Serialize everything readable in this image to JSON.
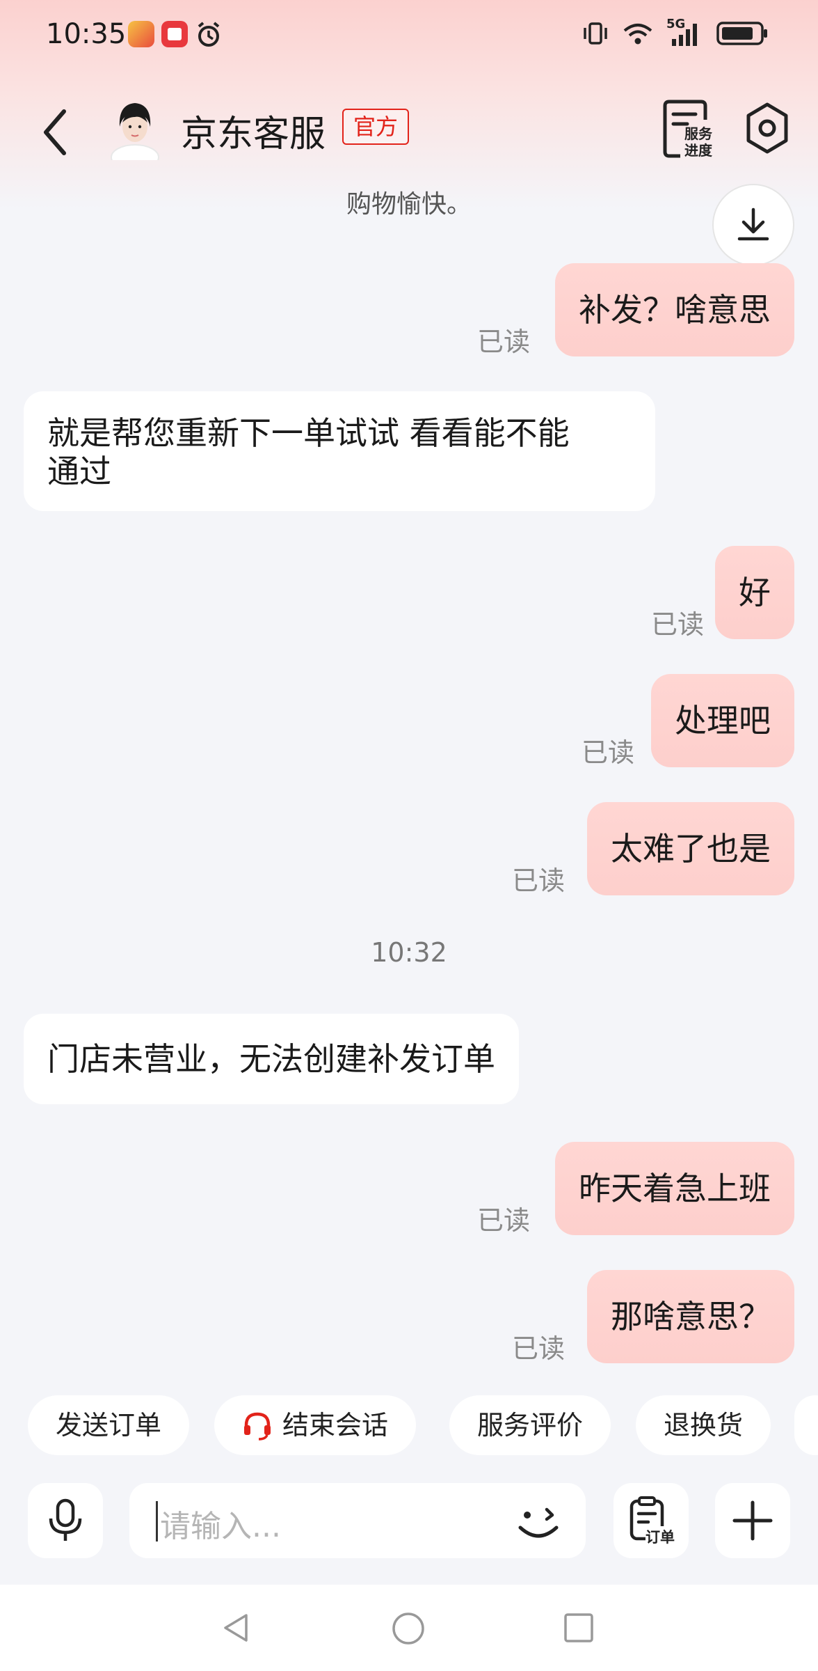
{
  "status_bar": {
    "time": "10:35",
    "network": "5G"
  },
  "header": {
    "agent_name": "京东客服",
    "badge": "官方",
    "progress_label_line1": "服务",
    "progress_label_line2": "进度"
  },
  "system_text": "购物愉快。",
  "messages": [
    {
      "dir": "out",
      "text": "补发？啥意思",
      "status": "已读"
    },
    {
      "dir": "in",
      "line1": "就是帮您重新下一单试试 看看能不能",
      "line2": "通过"
    },
    {
      "dir": "out",
      "text": "好",
      "status": "已读"
    },
    {
      "dir": "out",
      "text": "处理吧",
      "status": "已读"
    },
    {
      "dir": "out",
      "text": "太难了也是",
      "status": "已读"
    },
    {
      "dir": "in",
      "text": "门店未营业，无法创建补发订单"
    },
    {
      "dir": "out",
      "text": "昨天着急上班",
      "status": "已读"
    },
    {
      "dir": "out",
      "text": "那啥意思？",
      "status": "已读"
    }
  ],
  "time_separator": "10:32",
  "quick_actions": [
    "发送订单",
    "结束会话",
    "服务评价",
    "退换货"
  ],
  "input": {
    "placeholder": "请输入...",
    "order_label": "订单"
  },
  "colors": {
    "accent_red": "#e2231a",
    "bubble_out": "#fdcfcc",
    "background": "#f4f5f9"
  },
  "icons": [
    "back-icon",
    "avatar",
    "service-progress-icon",
    "settings-hex-icon",
    "download-icon",
    "headset-icon",
    "microphone-icon",
    "emoji-icon",
    "order-icon",
    "plus-icon",
    "nav-back-icon",
    "nav-home-icon",
    "nav-recents-icon"
  ]
}
